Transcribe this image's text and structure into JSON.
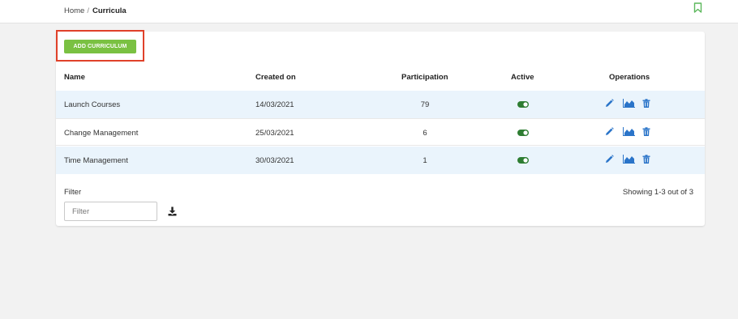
{
  "breadcrumb": {
    "home": "Home",
    "separator": "/",
    "current": "Curricula"
  },
  "toolbar": {
    "add_label": "ADD CURRICULUM"
  },
  "table": {
    "headers": {
      "name": "Name",
      "created_on": "Created on",
      "participation": "Participation",
      "active": "Active",
      "operations": "Operations"
    },
    "rows": [
      {
        "name": "Launch Courses",
        "created_on": "14/03/2021",
        "participation": "79",
        "active": true
      },
      {
        "name": "Change Management",
        "created_on": "25/03/2021",
        "participation": "6",
        "active": true
      },
      {
        "name": "Time Management",
        "created_on": "30/03/2021",
        "participation": "1",
        "active": true
      }
    ]
  },
  "filter": {
    "label": "Filter",
    "placeholder": "Filter",
    "value": ""
  },
  "pagination": {
    "showing": "Showing 1-3 out of 3"
  },
  "icons": {
    "bookmark": "bookmark-icon",
    "toggle": "toggle-on-icon",
    "edit": "pencil-icon",
    "stats": "area-chart-icon",
    "delete": "trash-icon",
    "download": "download-icon"
  },
  "colors": {
    "accent_green": "#7ac142",
    "toggle_green": "#2e7d32",
    "operation_blue": "#2a74c9",
    "highlight_red": "#e0412a",
    "row_alt_bg": "#eaf4fc"
  }
}
